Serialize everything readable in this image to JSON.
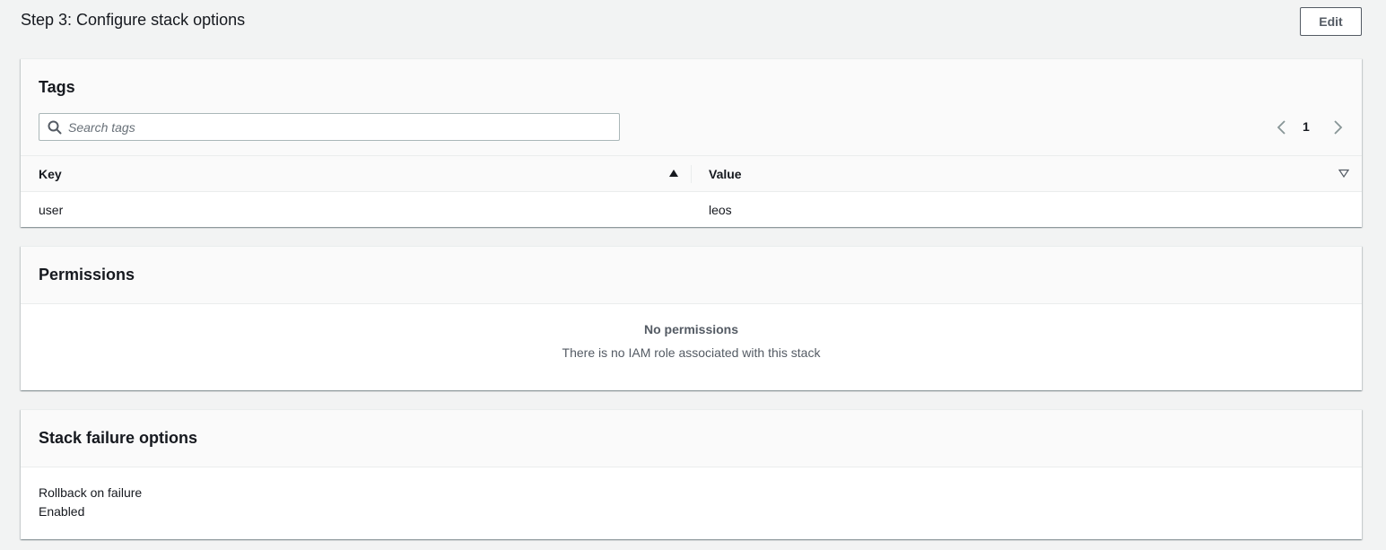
{
  "step": {
    "title": "Step 3: Configure stack options",
    "edit_label": "Edit"
  },
  "tags": {
    "title": "Tags",
    "search_placeholder": "Search tags",
    "page": "1",
    "columns": {
      "key": "Key",
      "value": "Value"
    },
    "rows": [
      {
        "key": "user",
        "value": "leos"
      }
    ]
  },
  "permissions": {
    "title": "Permissions",
    "empty_title": "No permissions",
    "empty_description": "There is no IAM role associated with this stack"
  },
  "failure": {
    "title": "Stack failure options",
    "label": "Rollback on failure",
    "value": "Enabled"
  },
  "icons": {
    "search": "search-icon",
    "prev": "chevron-left-icon",
    "next": "chevron-right-icon",
    "sort_asc": "caret-up-filled-icon",
    "sort_none": "caret-down-outline-icon"
  },
  "colors": {
    "background": "#f2f3f3",
    "panel_header": "#fafafa",
    "text": "#16191f",
    "secondary_text": "#545b64",
    "border": "#aab7b8"
  }
}
